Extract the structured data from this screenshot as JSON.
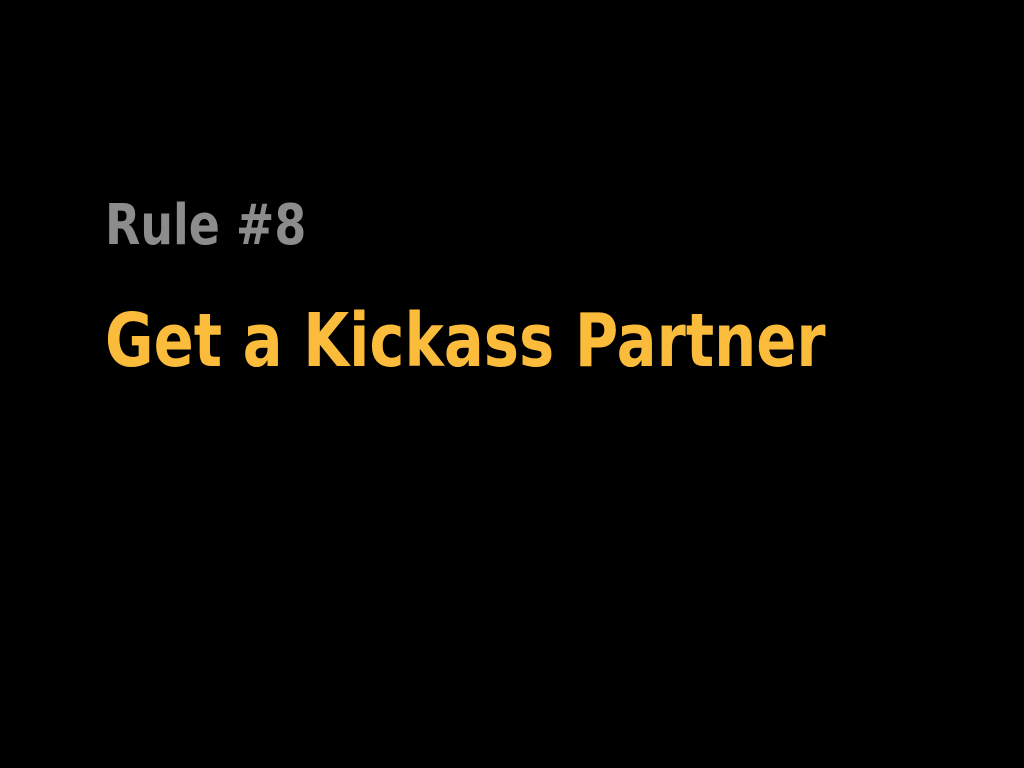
{
  "slide": {
    "rule_label": "Rule #8",
    "title": "Get a Kickass Partner"
  },
  "colors": {
    "background": "#000000",
    "rule_label": "#8c8c8c",
    "title": "#fbbc3c"
  }
}
